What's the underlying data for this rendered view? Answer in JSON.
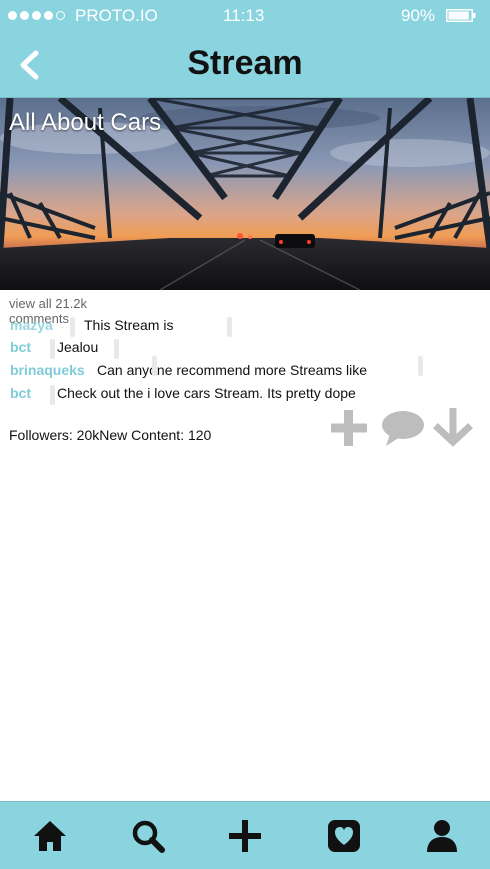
{
  "status_bar": {
    "carrier": "PROTO.IO",
    "time": "11:13",
    "battery": "90%",
    "battery_level": 0.9
  },
  "nav": {
    "title": "Stream"
  },
  "hero": {
    "title": "All About Cars"
  },
  "comments": {
    "view_all": "view all 21.2k",
    "overflow_label": "comments",
    "items": [
      {
        "user": "mazya",
        "text": "This Stream is"
      },
      {
        "user": "bct",
        "text": "Jealou"
      },
      {
        "user": "brinaqueks",
        "text": "Can anyone recommend more Streams like"
      },
      {
        "user": "bct",
        "text": "Check out the i love cars Stream. Its pretty dope"
      }
    ]
  },
  "stats": {
    "followers": "Followers: 20k",
    "new_content": "New Content: 120"
  },
  "colors": {
    "accent": "#8ad4df",
    "username": "#7fcbd8",
    "action_icon": "#bdbdbd"
  },
  "actions": [
    "plus-icon",
    "comment-icon",
    "download-icon"
  ],
  "tabs": [
    "home-icon",
    "search-icon",
    "add-icon",
    "favorites-icon",
    "profile-icon"
  ]
}
